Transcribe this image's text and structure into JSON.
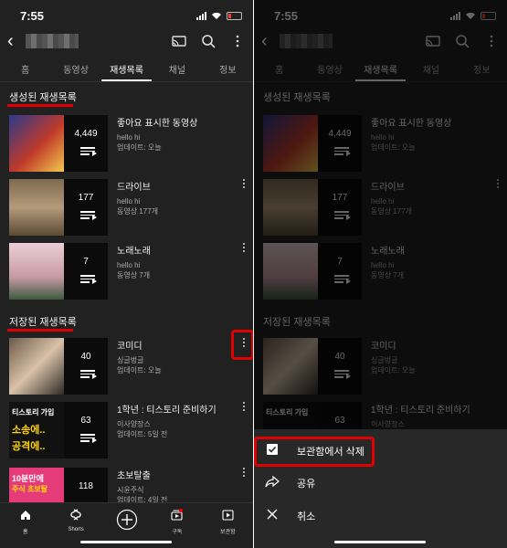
{
  "status": {
    "time": "7:55"
  },
  "tabs": [
    "홈",
    "동영상",
    "재생목록",
    "채널",
    "정보"
  ],
  "sections": {
    "created": "생성된 재생목록",
    "saved": "저장된 재생목록"
  },
  "playlists": [
    {
      "title": "좋아요 표시한 동영상",
      "line1": "hello hi",
      "line2": "업데이트: 오늘",
      "count": "4,449"
    },
    {
      "title": "드라이브",
      "line1": "hello hi",
      "line2": "동영상 177개",
      "count": "177"
    },
    {
      "title": "노래노래",
      "line1": "hello hi",
      "line2": "동영상 7개",
      "count": "7"
    },
    {
      "title": "코미디",
      "line1": "싱글벙글",
      "line2": "업데이트: 오늘",
      "count": "40"
    },
    {
      "title": "1학년 : 티스토리 준비하기",
      "line1": "이사양장스",
      "line2": "업데이트: 5일 전",
      "count": "63"
    },
    {
      "title": "",
      "line1": "",
      "line2": "",
      "count": "118"
    },
    {
      "title": "초보탈출",
      "line1": "시윤주식",
      "line2": "업데이트: 4일 전",
      "count": "118"
    }
  ],
  "thumb_text": {
    "comedy_caption": "심수현",
    "tistory_line1": "티스토리 가입",
    "tistory_line2": "소송에..",
    "tistory_line3": "공격에..",
    "stock_line1": "10분만에",
    "stock_line2": "주식 초보탈"
  },
  "nav": [
    {
      "label": "홈",
      "icon": "home-icon"
    },
    {
      "label": "Shorts",
      "icon": "shorts-icon"
    },
    {
      "label": "",
      "icon": "create-icon"
    },
    {
      "label": "구독",
      "icon": "subscriptions-icon"
    },
    {
      "label": "보관함",
      "icon": "library-icon"
    }
  ],
  "sheet": [
    {
      "label": "보관함에서 삭제",
      "icon": "remove-from-library-icon"
    },
    {
      "label": "공유",
      "icon": "share-icon"
    },
    {
      "label": "취소",
      "icon": "close-icon"
    }
  ],
  "colors": {
    "accent": "#e30000",
    "background": "#212121",
    "sheet": "#282828",
    "notification": "#ff0000"
  }
}
